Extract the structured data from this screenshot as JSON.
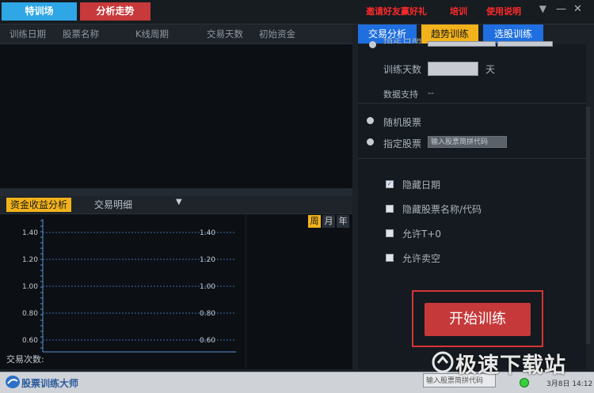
{
  "top": {
    "train_tab": "特训场",
    "analysis_tab": "分析走势",
    "invite": "邀请好友赢好礼",
    "training": "培训",
    "manual": "使用说明"
  },
  "table": {
    "columns": [
      "训练日期",
      "股票名称",
      "K线周期",
      "交易天数",
      "初始资金"
    ]
  },
  "bottom_tabs": {
    "fund": "资金收益分析",
    "detail": "交易明细"
  },
  "period": [
    "周",
    "月",
    "年"
  ],
  "chart_data": {
    "type": "line",
    "yticks": [
      "1.40",
      "1.20",
      "1.00",
      "0.80",
      "0.60"
    ],
    "ylim": [
      0.6,
      1.4
    ],
    "xlabel": "交易次数:",
    "series": []
  },
  "right_tabs": [
    "交易分析",
    "趋势训练",
    "选股训练"
  ],
  "right": {
    "specify_date": "指定日期",
    "train_days": "训练天数",
    "days_unit": "天",
    "data_support": "数据支持",
    "data_support_value": "--",
    "random_stock": "随机股票",
    "specify_stock": "指定股票",
    "stock_placeholder": "输入股票简拼代码",
    "hide_date": "隐藏日期",
    "hide_name": "隐藏股票名称/代码",
    "allow_t0": "允许T+0",
    "allow_short": "允许卖空",
    "start": "开始训练"
  },
  "status": {
    "app_name": "股票训练大师",
    "input_placeholder": "输入股票简拼代码",
    "datetime": "3月8日 14:12"
  },
  "watermark": "极速下载站",
  "colors": {
    "accent_blue": "#2fa6e5",
    "accent_red": "#c7393b",
    "accent_yellow": "#f2b21b",
    "tab_blue": "#1f6fe0"
  }
}
